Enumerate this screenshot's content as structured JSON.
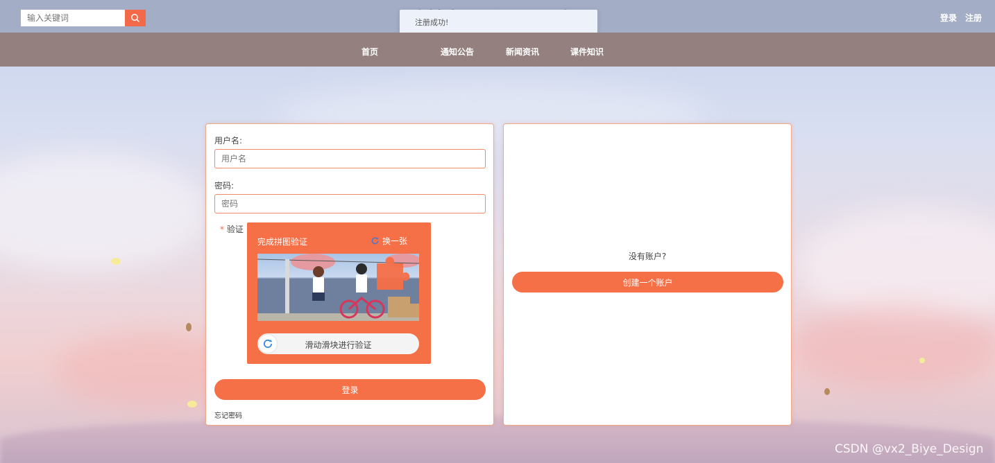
{
  "header": {
    "search_placeholder": "输入关键词",
    "site_title": "计算机课程与设计",
    "login": "登录",
    "register": "注册"
  },
  "toast": {
    "message": "注册成功!"
  },
  "nav": {
    "items": [
      {
        "label": "首页"
      },
      {
        "label": "通知公告"
      },
      {
        "label": "新闻资讯"
      },
      {
        "label": "课件知识"
      }
    ]
  },
  "login_form": {
    "username_label": "用户名:",
    "username_placeholder": "用户名",
    "password_label": "密码:",
    "password_placeholder": "密码",
    "captcha_required_mark": "*",
    "captcha_label": "验证",
    "captcha_title": "完成拼图验证",
    "captcha_refresh": "换一张",
    "slider_text": "滑动滑块进行验证",
    "submit": "登录",
    "forgot_password": "忘记密码"
  },
  "signup_panel": {
    "prompt": "没有账户?",
    "create_button": "创建一个账户"
  },
  "watermark": "CSDN @vx2_Biye_Design",
  "colors": {
    "accent": "#f56f47",
    "nav_bg": "#94817f",
    "header_bg": "#a3adc6"
  }
}
